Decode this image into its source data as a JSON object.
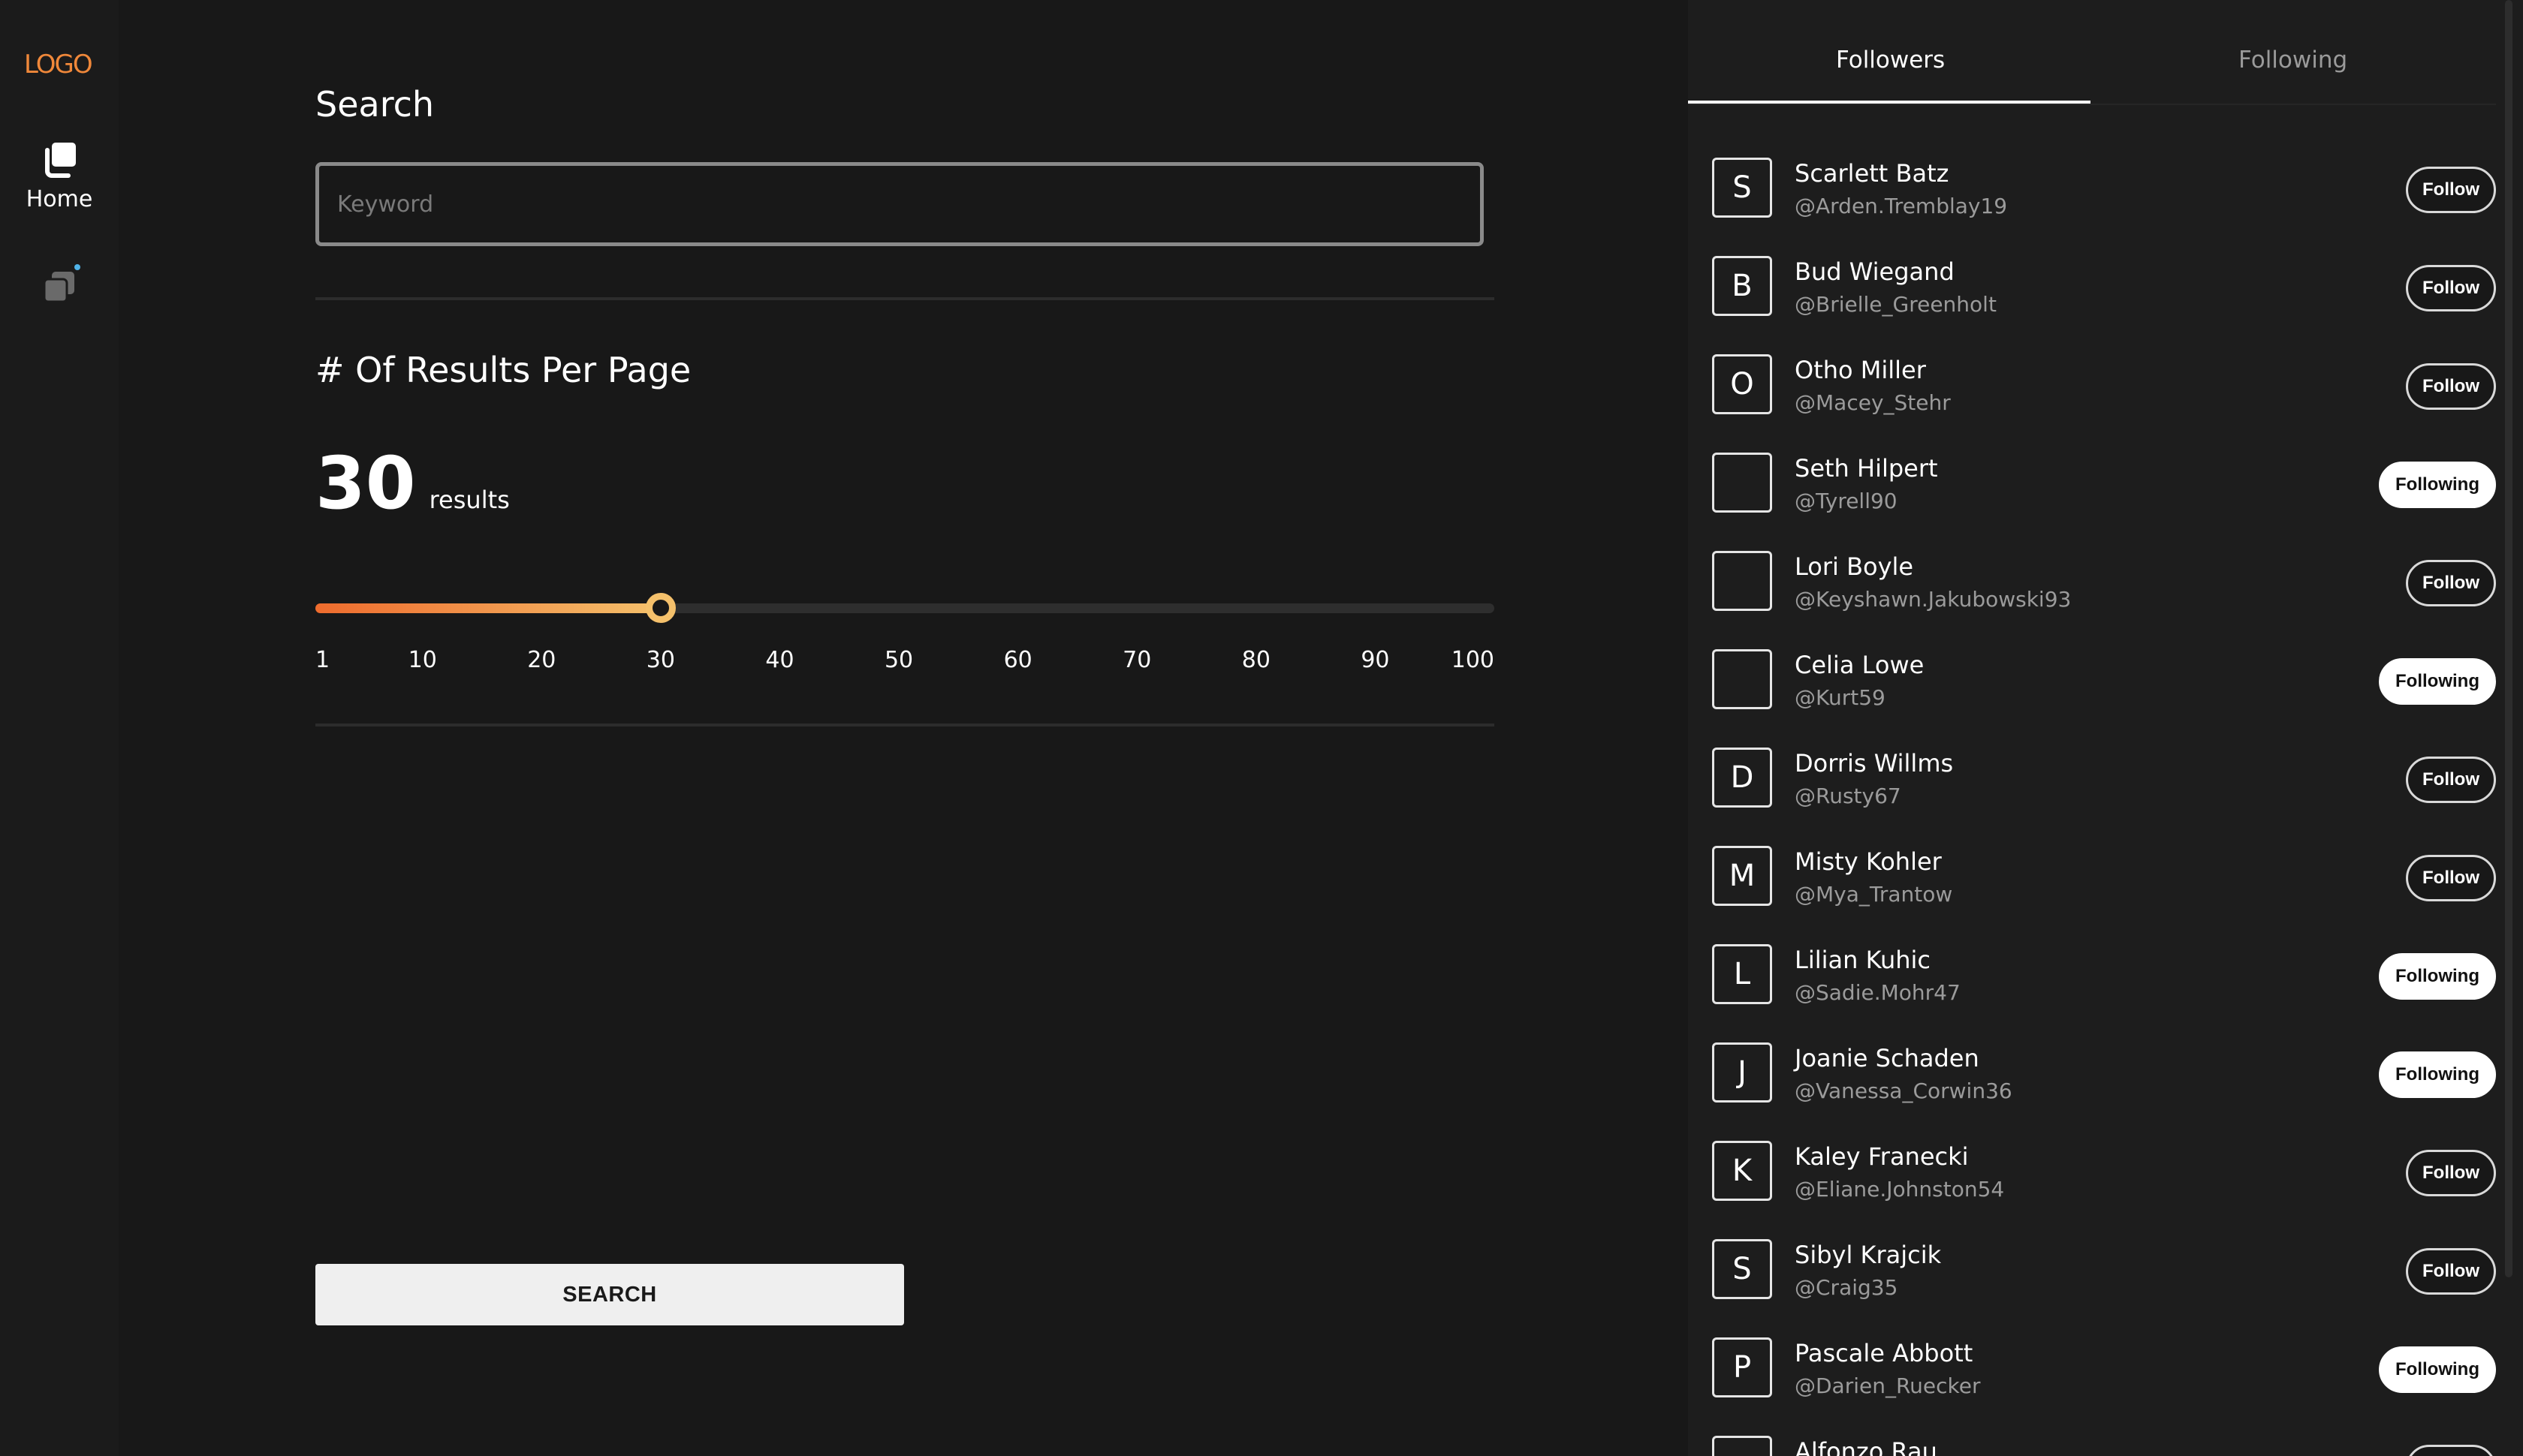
{
  "nav": {
    "logo": "LOGO",
    "items": [
      {
        "label": "Home",
        "icon": "stacked-squares-icon",
        "active": true
      },
      {
        "label": "",
        "icon": "stacked-squares-icon",
        "badge": true,
        "badge_color": "#4fb3e8"
      }
    ]
  },
  "search": {
    "title": "Search",
    "placeholder": "Keyword",
    "value": ""
  },
  "results_per_page": {
    "title": "# Of Results Per Page",
    "value": "30",
    "unit": "results",
    "slider": {
      "min": 1,
      "max": 100,
      "value": 30,
      "ticks": [
        "1",
        "10",
        "20",
        "30",
        "40",
        "50",
        "60",
        "70",
        "80",
        "90",
        "100"
      ],
      "track_gradient": [
        "#ee6b2d",
        "#f4c06b"
      ]
    }
  },
  "search_button": {
    "label": "SEARCH"
  },
  "panel": {
    "tabs": [
      {
        "label": "Followers",
        "active": true
      },
      {
        "label": "Following",
        "active": false
      }
    ],
    "users": [
      {
        "initial": "S",
        "name": "Scarlett Batz",
        "handle": "@Arden.Tremblay19",
        "button": "Follow"
      },
      {
        "initial": "B",
        "name": "Bud Wiegand",
        "handle": "@Brielle_Greenholt",
        "button": "Follow"
      },
      {
        "initial": "O",
        "name": "Otho Miller",
        "handle": "@Macey_Stehr",
        "button": "Follow"
      },
      {
        "initial": "",
        "name": "Seth Hilpert",
        "handle": "@Tyrell90",
        "button": "Following"
      },
      {
        "initial": "",
        "name": "Lori Boyle",
        "handle": "@Keyshawn.Jakubowski93",
        "button": "Follow"
      },
      {
        "initial": "",
        "name": "Celia Lowe",
        "handle": "@Kurt59",
        "button": "Following"
      },
      {
        "initial": "D",
        "name": "Dorris Willms",
        "handle": "@Rusty67",
        "button": "Follow"
      },
      {
        "initial": "M",
        "name": "Misty Kohler",
        "handle": "@Mya_Trantow",
        "button": "Follow"
      },
      {
        "initial": "L",
        "name": "Lilian Kuhic",
        "handle": "@Sadie.Mohr47",
        "button": "Following"
      },
      {
        "initial": "J",
        "name": "Joanie Schaden",
        "handle": "@Vanessa_Corwin36",
        "button": "Following"
      },
      {
        "initial": "K",
        "name": "Kaley Franecki",
        "handle": "@Eliane.Johnston54",
        "button": "Follow"
      },
      {
        "initial": "S",
        "name": "Sibyl Krajcik",
        "handle": "@Craig35",
        "button": "Follow"
      },
      {
        "initial": "P",
        "name": "Pascale Abbott",
        "handle": "@Darien_Ruecker",
        "button": "Following"
      },
      {
        "initial": "",
        "name": "Alfonzo Rau",
        "handle": "",
        "button": "Follow"
      }
    ]
  }
}
